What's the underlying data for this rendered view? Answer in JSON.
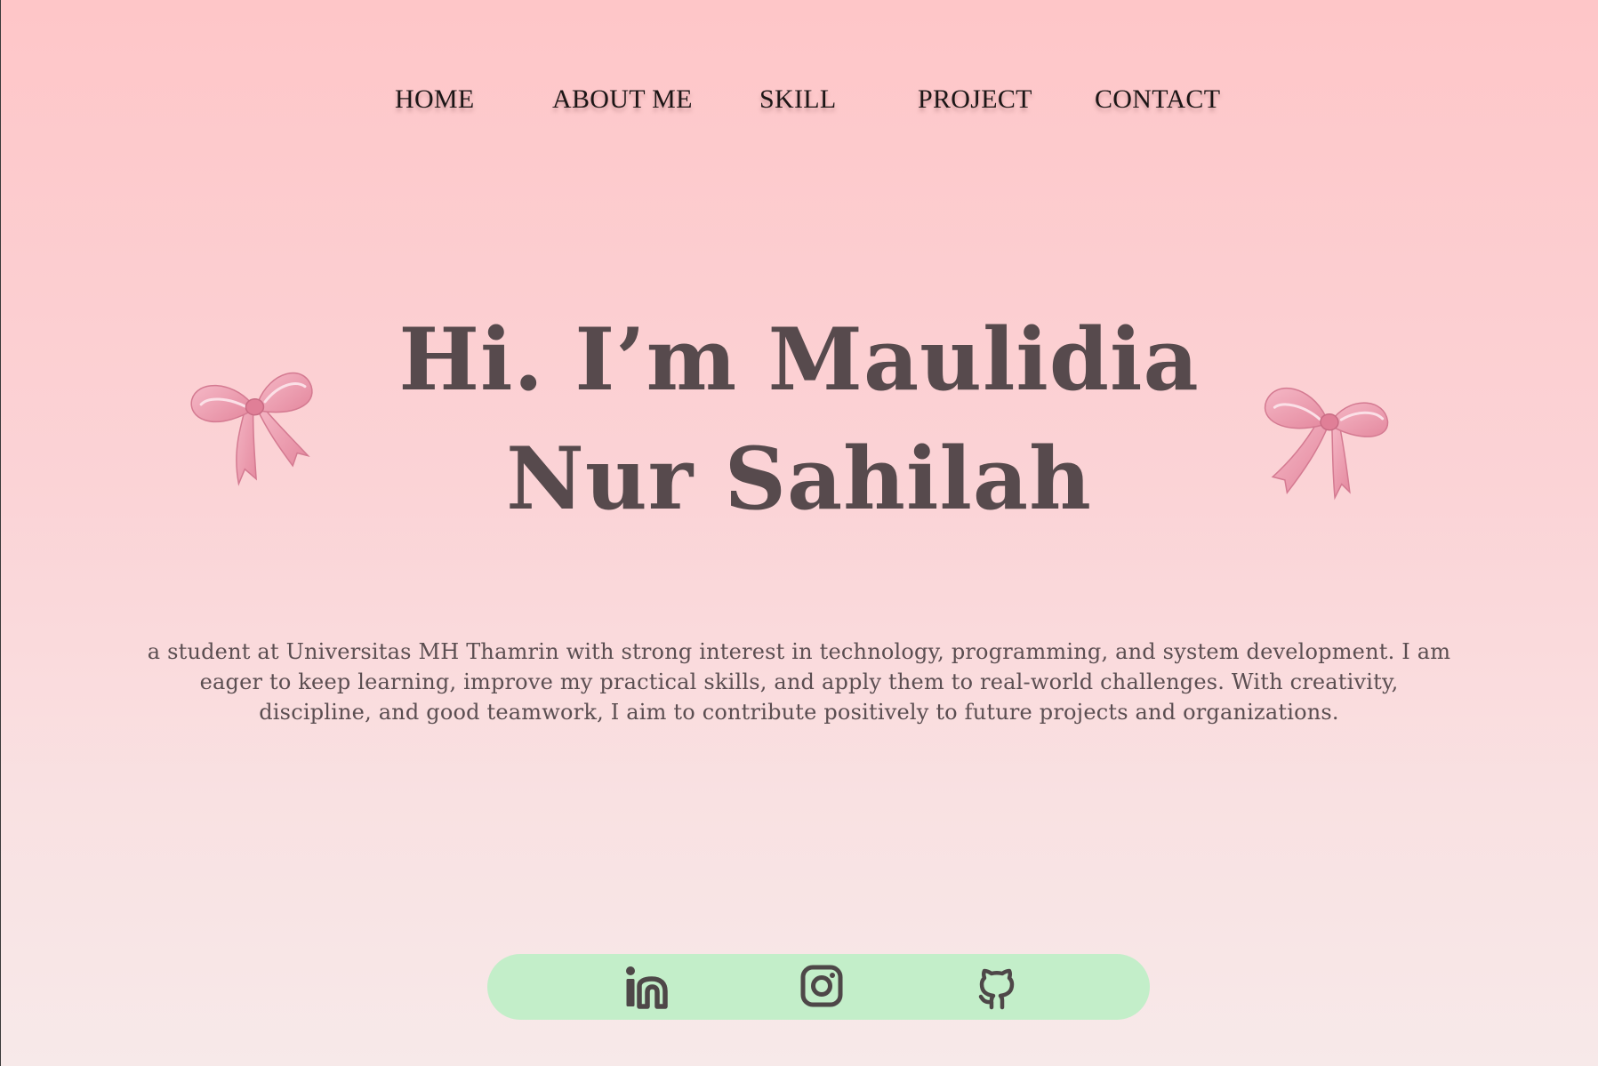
{
  "nav": {
    "items": [
      {
        "label": "HOME"
      },
      {
        "label": "ABOUT ME"
      },
      {
        "label": "SKILL"
      },
      {
        "label": "PROJECT"
      },
      {
        "label": "CONTACT"
      }
    ]
  },
  "hero": {
    "title_line1": "Hi. I’m Maulidia",
    "title_line2": "Nur Sahilah",
    "description": "a student at Universitas MH Thamrin with strong interest in technology, programming, and system development. I am eager to keep learning, improve my practical skills, and apply them to real-world challenges. With creativity, discipline, and good teamwork, I aim to contribute positively to future projects and organizations."
  },
  "decorations": {
    "left_icon": "pink-ribbon-bow-icon",
    "right_icon": "pink-ribbon-bow-icon"
  },
  "social": {
    "icons": [
      "linkedin-icon",
      "instagram-icon",
      "github-icon"
    ]
  },
  "colors": {
    "background_top": "#fec6c8",
    "background_bottom": "#f7e9e9",
    "text": "#574a4d",
    "social_bar": "#c3eec9",
    "ribbon": "#e88fa3"
  }
}
